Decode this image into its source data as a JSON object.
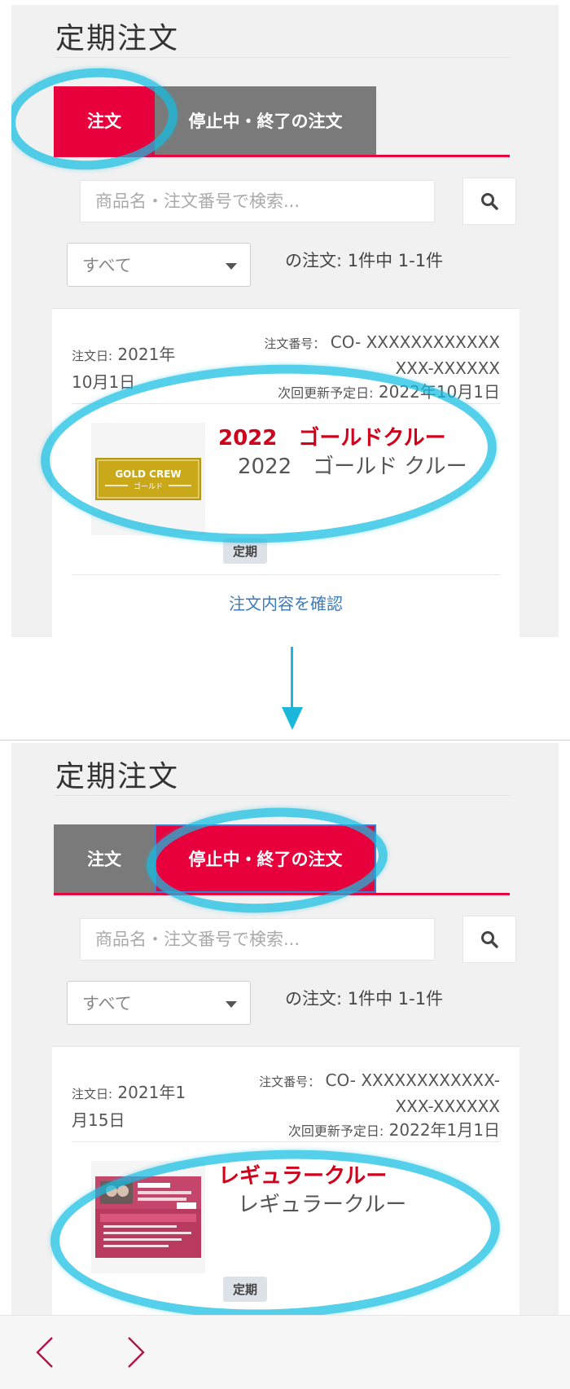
{
  "colors": {
    "accent_red": "#e8003c",
    "product_red": "#d0021b",
    "tab_inactive": "#7a7a7a",
    "link_blue": "#3a7bbf",
    "highlight_cyan": "#14bee2"
  },
  "panel1": {
    "page_title": "定期注文",
    "tabs": [
      {
        "label": "注文",
        "active": true
      },
      {
        "label": "停止中・終了の注文",
        "active": false
      }
    ],
    "search": {
      "placeholder": "商品名・注文番号で検索...",
      "icon": "search-icon"
    },
    "filter": {
      "selected": "すべて",
      "icon": "chevron-down-icon"
    },
    "count_text": "の注文: 1件中 1-1件",
    "order": {
      "date_label": "注文日:",
      "date_line1": "2021年",
      "date_line2": "10月1日",
      "number_label": "注文番号：",
      "number_line1": "CO- XXXXXXXXXXXX",
      "number_line2": "XXX-XXXXXX",
      "next_label": "次回更新予定日:",
      "next_date": "2022年10月1日",
      "product_title": "2022　ゴールドクルー",
      "product_sub": "2022　ゴールド クルー",
      "thumb_text_1": "GOLD CREW",
      "thumb_text_2": "ゴールド",
      "badge": "定期",
      "details_link": "注文内容を確認"
    }
  },
  "panel2": {
    "page_title": "定期注文",
    "tabs": [
      {
        "label": "注文",
        "active": false
      },
      {
        "label": "停止中・終了の注文",
        "active": true
      }
    ],
    "search": {
      "placeholder": "商品名・注文番号で検索...",
      "icon": "search-icon"
    },
    "filter": {
      "selected": "すべて",
      "icon": "chevron-down-icon"
    },
    "count_text": "の注文: 1件中 1-1件",
    "order": {
      "date_label": "注文日:",
      "date_line1": "2021年1",
      "date_line2": "月15日",
      "number_label": "注文番号：",
      "number_line1": "CO- XXXXXXXXXXXX-",
      "number_line2": "XXX-XXXXXX",
      "next_label": "次回更新予定日:",
      "next_date": "2022年1月1日",
      "product_title": "レギュラークルー",
      "product_sub": "レギュラークルー",
      "badge": "定期"
    }
  },
  "nav": {
    "back_icon": "chevron-left-icon",
    "forward_icon": "chevron-right-icon"
  }
}
